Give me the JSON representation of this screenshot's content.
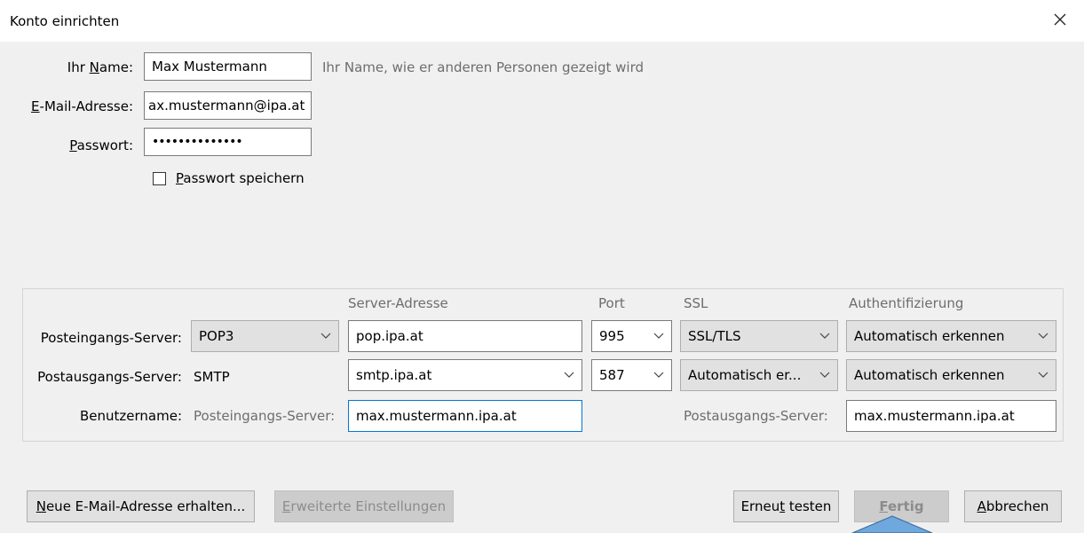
{
  "window": {
    "title": "Konto einrichten"
  },
  "account": {
    "name_label_pre": "Ihr ",
    "name_label_ul": "N",
    "name_label_post": "ame:",
    "name_value": "Max Mustermann",
    "name_hint": "Ihr Name, wie er anderen Personen gezeigt wird",
    "email_label_ul": "E",
    "email_label_post": "-Mail-Adresse:",
    "email_value": "ax.mustermann@ipa.at",
    "password_label_ul": "P",
    "password_label_post": "asswort:",
    "password_value": "••••••••••••••",
    "save_password_ul": "P",
    "save_password_post": "asswort speichern",
    "save_password_checked": false
  },
  "server": {
    "headers": {
      "address": "Server-Adresse",
      "port": "Port",
      "ssl": "SSL",
      "auth": "Authentifizierung"
    },
    "incoming": {
      "label": "Posteingangs-Server:",
      "protocol": "POP3",
      "address": "pop.ipa.at",
      "port": "995",
      "ssl": "SSL/TLS",
      "auth": "Automatisch erkennen"
    },
    "outgoing": {
      "label": "Postausgangs-Server:",
      "protocol": "SMTP",
      "address": "smtp.ipa.at",
      "port": "587",
      "ssl": "Automatisch er...",
      "auth": "Automatisch erkennen"
    },
    "username": {
      "label": "Benutzername:",
      "incoming_label": "Posteingangs-Server:",
      "incoming_value": "max.mustermann.ipa.at",
      "outgoing_label": "Postausgangs-Server:",
      "outgoing_value": "max.mustermann.ipa.at"
    }
  },
  "buttons": {
    "new_address_ul": "N",
    "new_address_post": "eue E-Mail-Adresse erhalten...",
    "advanced_ul": "E",
    "advanced_post": "rweiterte Einstellungen",
    "retest_pre": "Erneu",
    "retest_ul": "t",
    "retest_post": " testen",
    "done_ul": "F",
    "done_post": "ertig",
    "cancel_ul": "A",
    "cancel_post": "bbrechen"
  }
}
